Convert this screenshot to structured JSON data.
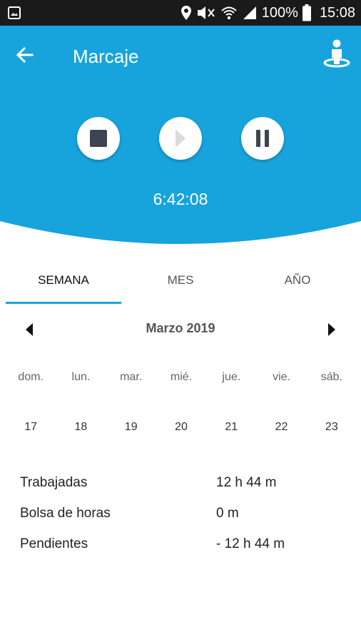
{
  "status_bar": {
    "battery_percent": "100%",
    "time": "15:08",
    "icons": [
      "gallery-icon",
      "location-icon",
      "mute-icon",
      "wifi-icon",
      "signal-icon",
      "battery-icon"
    ]
  },
  "header": {
    "title": "Marcaje",
    "timer": "6:42:08",
    "accent_color": "#17a4dd",
    "icons": [
      "back-arrow-icon",
      "person-location-icon",
      "stop-icon",
      "play-icon",
      "pause-icon"
    ]
  },
  "tabs": [
    {
      "label": "SEMANA",
      "selected": true
    },
    {
      "label": "MES",
      "selected": false
    },
    {
      "label": "AÑO",
      "selected": false
    }
  ],
  "calendar": {
    "month_label": "Marzo 2019",
    "weekday_labels": [
      "dom.",
      "lun.",
      "mar.",
      "mié.",
      "jue.",
      "vie.",
      "sáb."
    ],
    "days": [
      "17",
      "18",
      "19",
      "20",
      "21",
      "22",
      "23"
    ]
  },
  "summary": [
    {
      "label": "Trabajadas",
      "value": "12 h 44 m"
    },
    {
      "label": "Bolsa de horas",
      "value": "0 m"
    },
    {
      "label": "Pendientes",
      "value": "- 12 h 44 m"
    }
  ]
}
